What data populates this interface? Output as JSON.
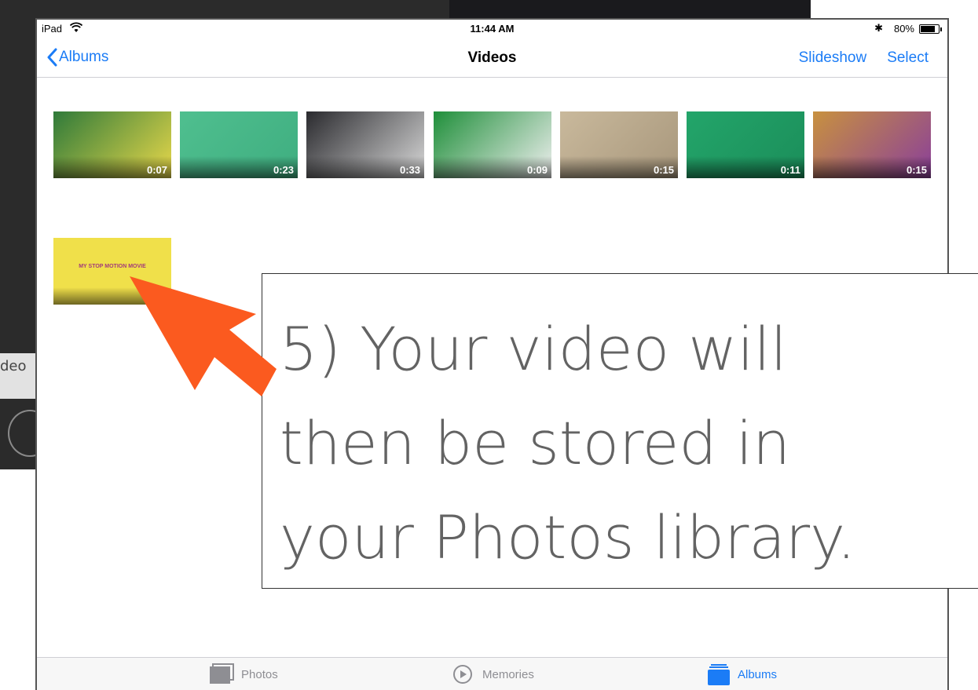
{
  "background_app": {
    "partial_text": "deo"
  },
  "status_bar": {
    "carrier": "iPad",
    "time": "11:44 AM",
    "battery_percent": "80%"
  },
  "nav": {
    "back_label": "Albums",
    "title": "Videos",
    "slideshow_label": "Slideshow",
    "select_label": "Select"
  },
  "videos": [
    {
      "duration": "0:07",
      "colors": [
        "#2f7a3a",
        "#e8d84a"
      ]
    },
    {
      "duration": "0:23",
      "colors": [
        "#4fbf8f",
        "#3fae80"
      ]
    },
    {
      "duration": "0:33",
      "colors": [
        "#2a2a2e",
        "#d9d9d9"
      ]
    },
    {
      "duration": "0:09",
      "colors": [
        "#1f8f3a",
        "#f0f0f0"
      ]
    },
    {
      "duration": "0:15",
      "colors": [
        "#c9b99c",
        "#a8977c"
      ]
    },
    {
      "duration": "0:11",
      "colors": [
        "#23a56a",
        "#1b8e5a"
      ]
    },
    {
      "duration": "0:15",
      "colors": [
        "#c8913f",
        "#8a3f9a"
      ]
    }
  ],
  "movie": {
    "title": "MY STOP MOTION MOVIE",
    "color": "#f0e04a"
  },
  "tabs": [
    {
      "label": "Photos",
      "active": false
    },
    {
      "label": "Memories",
      "active": false
    },
    {
      "label": "Albums",
      "active": true
    }
  ],
  "callout": {
    "text": "5) Your video will\nthen be stored in\nyour Photos library."
  },
  "colors": {
    "accent": "#1b7cf6",
    "arrow": "#fb5a1f"
  }
}
